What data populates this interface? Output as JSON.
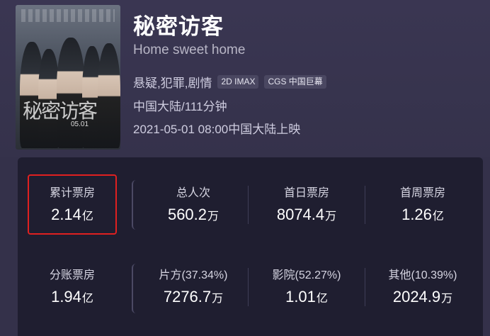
{
  "movie": {
    "title_cn": "秘密访客",
    "title_en": "Home sweet home",
    "genres": "悬疑,犯罪,剧情",
    "tags": [
      "2D IMAX",
      "CGS 中国巨幕"
    ],
    "region_duration": "中国大陆/111分钟",
    "release": "2021-05-01 08:00中国大陆上映",
    "poster": {
      "title": "秘密访客",
      "date": "05.01"
    }
  },
  "stats": {
    "row1": [
      {
        "label": "累计票房",
        "value": "2.14",
        "unit": "亿"
      },
      {
        "label": "总人次",
        "value": "560.2",
        "unit": "万"
      },
      {
        "label": "首日票房",
        "value": "8074.4",
        "unit": "万"
      },
      {
        "label": "首周票房",
        "value": "1.26",
        "unit": "亿"
      }
    ],
    "row2": [
      {
        "label": "分账票房",
        "value": "1.94",
        "unit": "亿"
      },
      {
        "label": "片方(37.34%)",
        "value": "7276.7",
        "unit": "万"
      },
      {
        "label": "影院(52.27%)",
        "value": "1.01",
        "unit": "亿"
      },
      {
        "label": "其他(10.39%)",
        "value": "2024.9",
        "unit": "万"
      }
    ]
  },
  "colors": {
    "highlight": "#e02020",
    "panel": "#1f1e30",
    "header": "#34314a"
  }
}
